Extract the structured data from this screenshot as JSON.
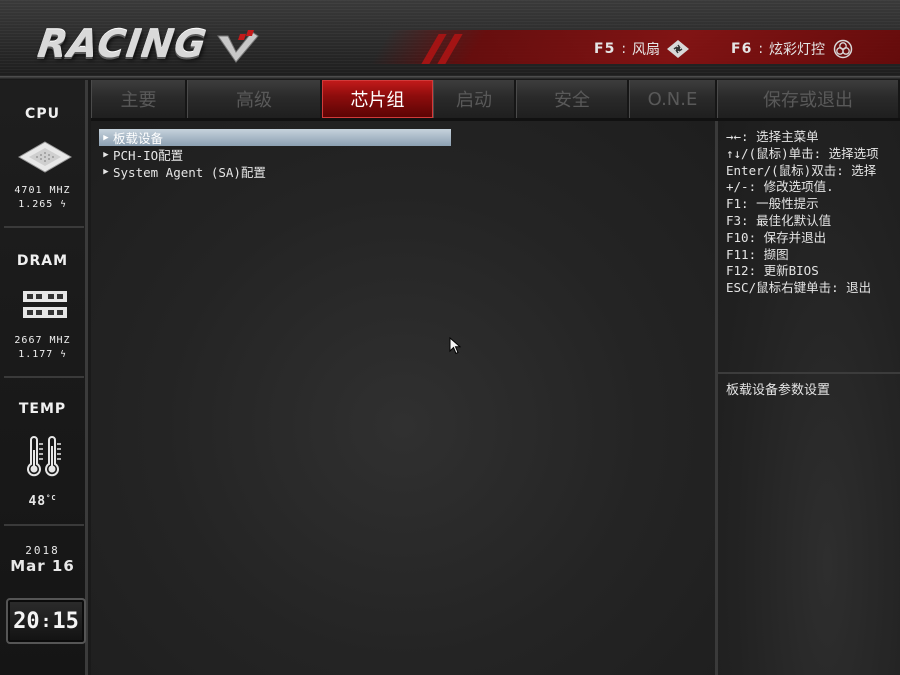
{
  "brand": {
    "logo_text": "RACING"
  },
  "hotkeys": [
    {
      "key": "F5",
      "sep": ":",
      "label": "风扇",
      "icon": "fan-icon"
    },
    {
      "key": "F6",
      "sep": ":",
      "label": "炫彩灯控",
      "icon": "rgb-light-icon"
    }
  ],
  "sidebar": {
    "cpu": {
      "title": "CPU",
      "freq": "4701 MHZ",
      "volt": "1.265",
      "icon": "cpu-chip-icon"
    },
    "dram": {
      "title": "DRAM",
      "freq": "2667 MHZ",
      "volt": "1.177",
      "icon": "ram-module-icon"
    },
    "temp": {
      "title": "TEMP",
      "value": "48",
      "unit": "°C",
      "icon": "thermometer-icon"
    },
    "date": {
      "year": "2018",
      "month_day": "Mar 16"
    },
    "clock": {
      "hours": "20",
      "minutes": "15"
    }
  },
  "tabs": [
    {
      "label": "主要",
      "active": false
    },
    {
      "label": "高级",
      "active": false
    },
    {
      "label": "芯片组",
      "active": true
    },
    {
      "label": "启动",
      "active": false
    },
    {
      "label": "安全",
      "active": false
    },
    {
      "label": "O.N.E",
      "active": false
    },
    {
      "label": "保存或退出",
      "active": false
    }
  ],
  "menu": [
    {
      "label": "板载设备",
      "selected": true
    },
    {
      "label": "PCH-IO配置",
      "selected": false
    },
    {
      "label": "System Agent (SA)配置",
      "selected": false
    }
  ],
  "help": {
    "keys": [
      "→←: 选择主菜单",
      "↑↓/(鼠标)单击: 选择选项",
      "Enter/(鼠标)双击: 选择",
      "+/-: 修改选项值.",
      "F1: 一般性提示",
      "F3: 最佳化默认值",
      "F10: 保存并退出",
      "F11: 撷图",
      "F12: 更新BIOS",
      "ESC/鼠标右键单击: 退出"
    ],
    "description": "板载设备参数设置"
  },
  "colors": {
    "accent_red": "#b01515",
    "selected_highlight": "#a9b9c8"
  }
}
